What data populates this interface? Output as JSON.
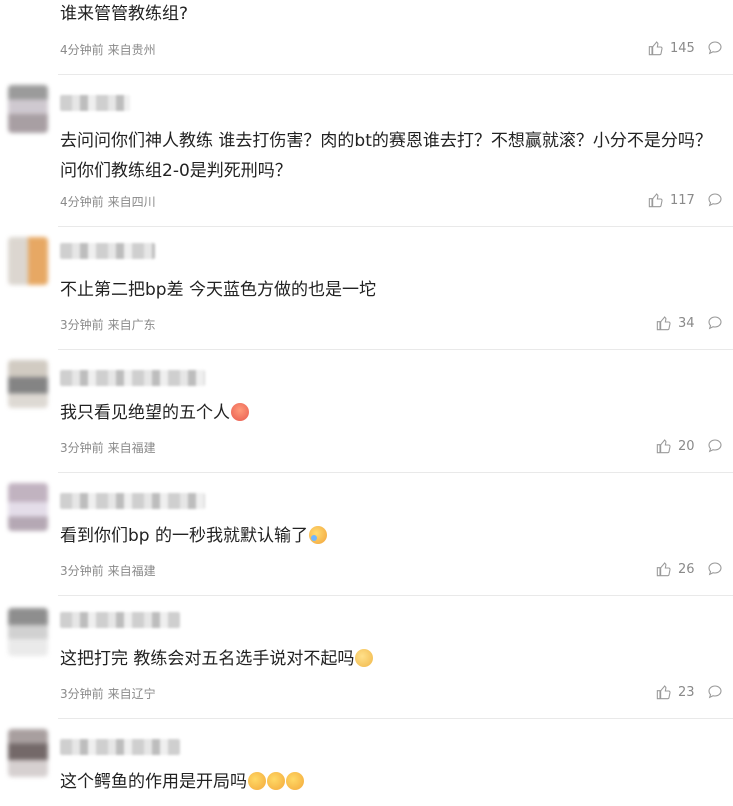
{
  "comments": [
    {
      "text": "谁来管管教练组?",
      "time": "4分钟前",
      "region": "来自贵州",
      "likes": "145"
    },
    {
      "text": "去问问你们神人教练 谁去打伤害？肉的bt的赛恩谁去打？不想赢就滚？小分不是分吗？问你们教练组2-0是判死刑吗？",
      "time": "4分钟前",
      "region": "来自四川",
      "likes": "117"
    },
    {
      "text": "不止第二把bp差 今天蓝色方做的也是一坨",
      "time": "3分钟前",
      "region": "来自广东",
      "likes": "34"
    },
    {
      "text": "我只看见绝望的五个人",
      "time": "3分钟前",
      "region": "来自福建",
      "likes": "20"
    },
    {
      "text": "看到你们bp 的一秒我就默认输了",
      "time": "3分钟前",
      "region": "来自福建",
      "likes": "26"
    },
    {
      "text": "这把打完 教练会对五名选手说对不起吗",
      "time": "3分钟前",
      "region": "来自辽宁",
      "likes": "23"
    },
    {
      "text": "这个鳄鱼的作用是开局吗",
      "time": "",
      "region": "",
      "likes": ""
    }
  ],
  "icons": {
    "like": "thumbs-up-icon",
    "reply": "comment-bubble-icon"
  }
}
